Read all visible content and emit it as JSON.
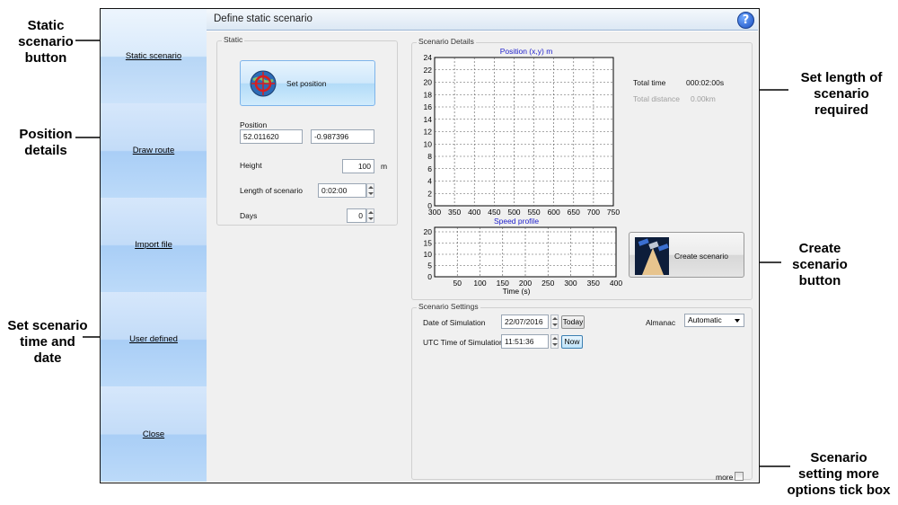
{
  "callouts": {
    "static_button": "Static\nscenario\nbutton",
    "position_details": "Position\ndetails",
    "time_date": "Set scenario\ntime and\ndate",
    "length": "Set length of\nscenario\nrequired",
    "create": "Create\nscenario\nbutton",
    "more": "Scenario\nsetting more\noptions tick box"
  },
  "sidebar": {
    "items": [
      {
        "label": "Static scenario"
      },
      {
        "label": "Draw route"
      },
      {
        "label": "Import file"
      },
      {
        "label": "User defined"
      },
      {
        "label": "Close"
      }
    ]
  },
  "window": {
    "title": "Define static scenario",
    "help_icon": "help-icon"
  },
  "static_group": {
    "label": "Static",
    "set_position_label": "Set position",
    "position_label": "Position",
    "latitude": "52.011620",
    "longitude": "-0.987396",
    "height_label": "Height",
    "height_value": "100",
    "height_unit": "m",
    "length_label": "Length of scenario",
    "length_value": "0:02:00",
    "days_label": "Days",
    "days_value": "0"
  },
  "details_group": {
    "label": "Scenario Details",
    "total_time_label": "Total time",
    "total_time_value": "000:02:00s",
    "total_distance_label": "Total distance",
    "total_distance_value": "0.00km",
    "create_label": "Create scenario"
  },
  "settings_group": {
    "label": "Scenario Settings",
    "date_label": "Date of Simulation",
    "date_value": "22/07/2016",
    "today_label": "Today",
    "utc_label": "UTC Time of Simulation",
    "utc_value": "11:51:36",
    "now_label": "Now",
    "almanac_label": "Almanac",
    "almanac_value": "Automatic",
    "more_label": "more"
  },
  "chart_data": [
    {
      "type": "scatter",
      "title": "Position (x,y) m",
      "xlim": [
        300,
        750
      ],
      "ylim": [
        0,
        24
      ],
      "x_ticks": [
        "300",
        "350",
        "400",
        "450",
        "500",
        "550",
        "600",
        "650",
        "700",
        "750"
      ],
      "y_ticks": [
        "0",
        "2",
        "4",
        "6",
        "8",
        "10",
        "12",
        "14",
        "16",
        "18",
        "20",
        "22",
        "24"
      ],
      "grid": true,
      "series": []
    },
    {
      "type": "line",
      "title": "Speed profile",
      "xlabel": "Time (s)",
      "xlim": [
        0,
        400
      ],
      "ylim": [
        0,
        22
      ],
      "x_ticks": [
        "50",
        "100",
        "150",
        "200",
        "250",
        "300",
        "350",
        "400"
      ],
      "y_ticks": [
        "0",
        "5",
        "10",
        "15",
        "20"
      ],
      "grid": true,
      "series": []
    }
  ]
}
